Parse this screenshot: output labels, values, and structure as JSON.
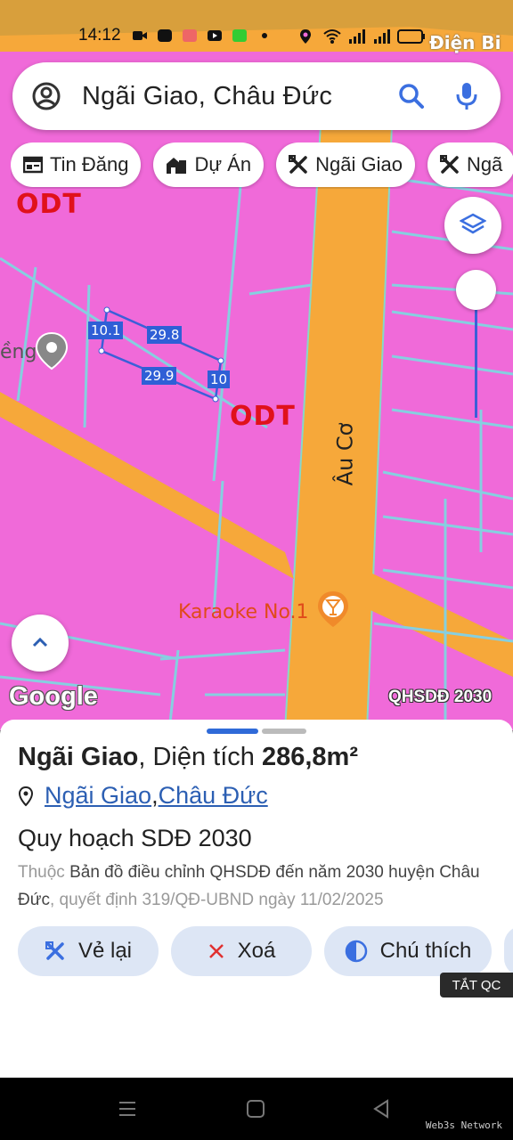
{
  "status_bar": {
    "time": "14:12"
  },
  "search": {
    "text": "Ngãi Giao, Châu Đức"
  },
  "chips": [
    {
      "label": "Tin Đăng",
      "icon": "newspaper-icon"
    },
    {
      "label": "Dự Án",
      "icon": "building-icon"
    },
    {
      "label": "Ngãi Giao",
      "icon": "tools-icon"
    },
    {
      "label": "Ngã",
      "icon": "tools-icon"
    }
  ],
  "map": {
    "top_right_fragment": "Điện Bi",
    "zone_labels": {
      "odt_1": "ODT",
      "odt_2": "ODT"
    },
    "partial_place": "ềng",
    "road_name": "Âu Cơ",
    "poi": "Karaoke No.1",
    "parcel_dims": {
      "top": "29.8",
      "bottom": "29.9",
      "left": "10.1",
      "right": "10"
    },
    "google": "Google",
    "layer_tag": "QHSDĐ 2030"
  },
  "sheet": {
    "title_place": "Ngãi Giao",
    "title_area_label": ", Diện tích ",
    "title_area_value": "286,8m²",
    "loc_commune": "Ngãi Giao",
    "loc_sep": ", ",
    "loc_district": "Châu Đức",
    "plan_title": "Quy hoạch SDĐ 2030",
    "desc_prefix": "Thuộc ",
    "desc_main": "Bản đồ điều chỉnh QHSDĐ đến năm 2030 huyện Châu Đức",
    "desc_suffix": ", quyết định 319/QĐ-UBND ngày 11/02/2025",
    "actions": [
      {
        "label": "Vẻ lại",
        "icon": "redraw-icon"
      },
      {
        "label": "Xoá",
        "icon": "close-icon"
      },
      {
        "label": "Chú thích",
        "icon": "legend-icon"
      }
    ]
  },
  "ad_tag": "TẮT QC",
  "watermark": "Web3s Network",
  "colors": {
    "zone_pink": "#f06ad9",
    "road_orange": "#f6a83a",
    "parcel_line": "#3b5fd8",
    "zone_label_red": "#e0111b",
    "link_blue": "#2c5fb3",
    "action_bg": "#dde6f5"
  }
}
